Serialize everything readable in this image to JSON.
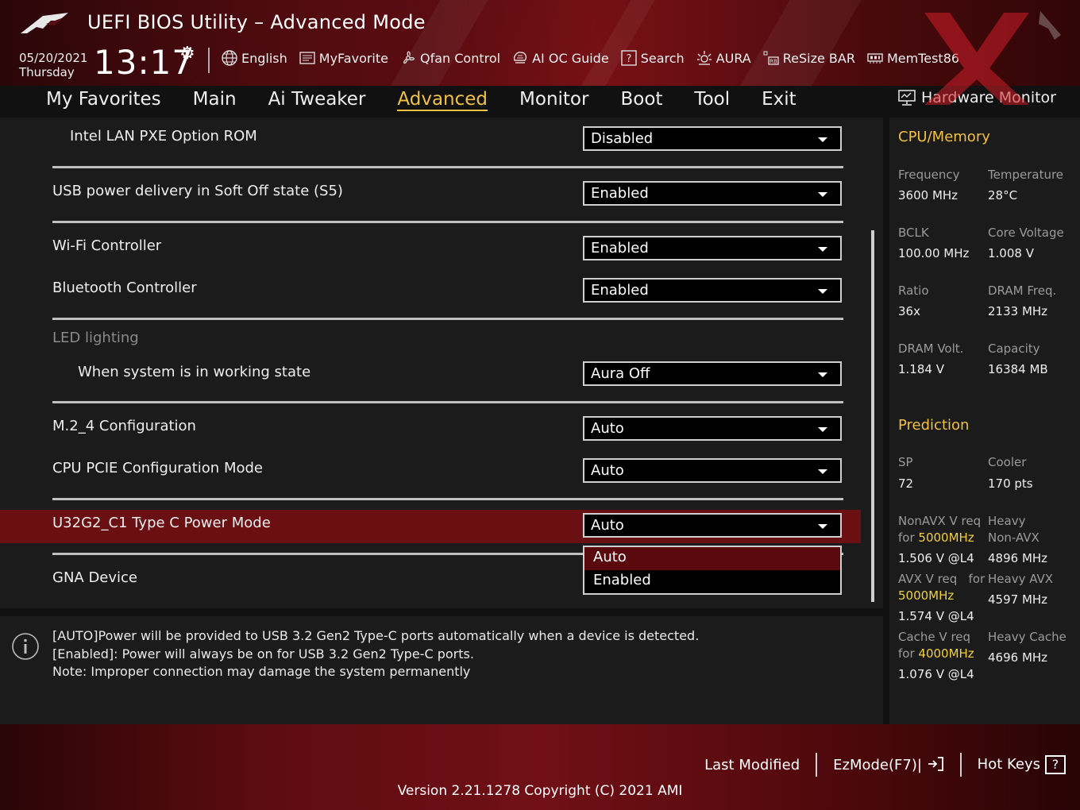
{
  "app": {
    "title": "UEFI BIOS Utility – Advanced Mode"
  },
  "datetime": {
    "date": "05/20/2021",
    "day": "Thursday",
    "time": "13:17"
  },
  "toolbar": {
    "items": [
      {
        "label": "English",
        "icon": "globe-icon"
      },
      {
        "label": "MyFavorite",
        "icon": "favorite-icon"
      },
      {
        "label": "Qfan Control",
        "icon": "fan-icon"
      },
      {
        "label": "AI OC Guide",
        "icon": "ai-oc-icon"
      },
      {
        "label": "Search",
        "icon": "search-icon"
      },
      {
        "label": "AURA",
        "icon": "aura-icon"
      },
      {
        "label": "ReSize BAR",
        "icon": "resize-bar-icon"
      },
      {
        "label": "MemTest86",
        "icon": "memtest-icon"
      }
    ]
  },
  "nav": {
    "tabs": [
      {
        "label": "My Favorites",
        "active": false
      },
      {
        "label": "Main",
        "active": false
      },
      {
        "label": "Ai Tweaker",
        "active": false
      },
      {
        "label": "Advanced",
        "active": true
      },
      {
        "label": "Monitor",
        "active": false
      },
      {
        "label": "Boot",
        "active": false
      },
      {
        "label": "Tool",
        "active": false
      },
      {
        "label": "Exit",
        "active": false
      }
    ]
  },
  "settings": {
    "intel_lan_pxe": {
      "label": "Intel LAN PXE Option ROM",
      "value": "Disabled"
    },
    "usb_power_s5": {
      "label": "USB power delivery in Soft Off state (S5)",
      "value": "Enabled"
    },
    "wifi": {
      "label": "Wi-Fi Controller",
      "value": "Enabled"
    },
    "bluetooth": {
      "label": "Bluetooth Controller",
      "value": "Enabled"
    },
    "led_group": {
      "label": "LED lighting"
    },
    "led_working": {
      "label": "When system is in working state",
      "value": "Aura Off"
    },
    "m2_4": {
      "label": "M.2_4 Configuration",
      "value": "Auto"
    },
    "cpu_pcie": {
      "label": "CPU PCIE Configuration Mode",
      "value": "Auto"
    },
    "u32g2": {
      "label": "U32G2_C1 Type C Power Mode",
      "value": "Auto",
      "options": [
        "Auto",
        "Enabled"
      ]
    },
    "gna": {
      "label": "GNA Device"
    }
  },
  "help": {
    "lines": [
      "[AUTO]Power will be provided to USB 3.2 Gen2 Type-C ports automatically when a device is detected.",
      "[Enabled]: Power will always be on for USB 3.2 Gen2 Type-C ports.",
      "Note: Improper connection may damage the system permanently"
    ]
  },
  "hw_monitor": {
    "title": "Hardware Monitor",
    "cpu_memory": {
      "section": "CPU/Memory",
      "frequency_label": "Frequency",
      "frequency": "3600 MHz",
      "temperature_label": "Temperature",
      "temperature": "28°C",
      "bclk_label": "BCLK",
      "bclk": "100.00 MHz",
      "core_voltage_label": "Core Voltage",
      "core_voltage": "1.008 V",
      "ratio_label": "Ratio",
      "ratio": "36x",
      "dram_freq_label": "DRAM Freq.",
      "dram_freq": "2133 MHz",
      "dram_volt_label": "DRAM Volt.",
      "dram_volt": "1.184 V",
      "capacity_label": "Capacity",
      "capacity": "16384 MB"
    },
    "prediction": {
      "section": "Prediction",
      "sp_label": "SP",
      "sp": "72",
      "cooler_label": "Cooler",
      "cooler": "170 pts",
      "nonavx_req_label": "NonAVX V req",
      "for": "for",
      "nonavx_freq": "5000MHz",
      "nonavx_volt": "1.506 V @L4",
      "heavy_label": "Heavy",
      "non_avx_label": "Non-AVX",
      "heavy_nonavx": "4896 MHz",
      "avx_req_label": "AVX V req",
      "avx_for": "for",
      "avx_freq": "5000MHz",
      "avx_volt": "1.574 V @L4",
      "heavy_avx_label": "Heavy AVX",
      "heavy_avx": "4597 MHz",
      "cache_req_label": "Cache V req",
      "cache_freq": "4000MHz",
      "cache_volt": "1.076 V @L4",
      "heavy_cache_label": "Heavy Cache",
      "heavy_cache": "4696 MHz"
    }
  },
  "footer": {
    "last_modified": "Last Modified",
    "ezmode": "EzMode(F7)|",
    "hot_keys": "Hot Keys",
    "hot_keys_box": "?",
    "version": "Version 2.21.1278 Copyright (C) 2021 AMI"
  },
  "colors": {
    "accent": "#f0c040",
    "highlight_row": "#6a0f12",
    "header_red": "#7a1116"
  }
}
